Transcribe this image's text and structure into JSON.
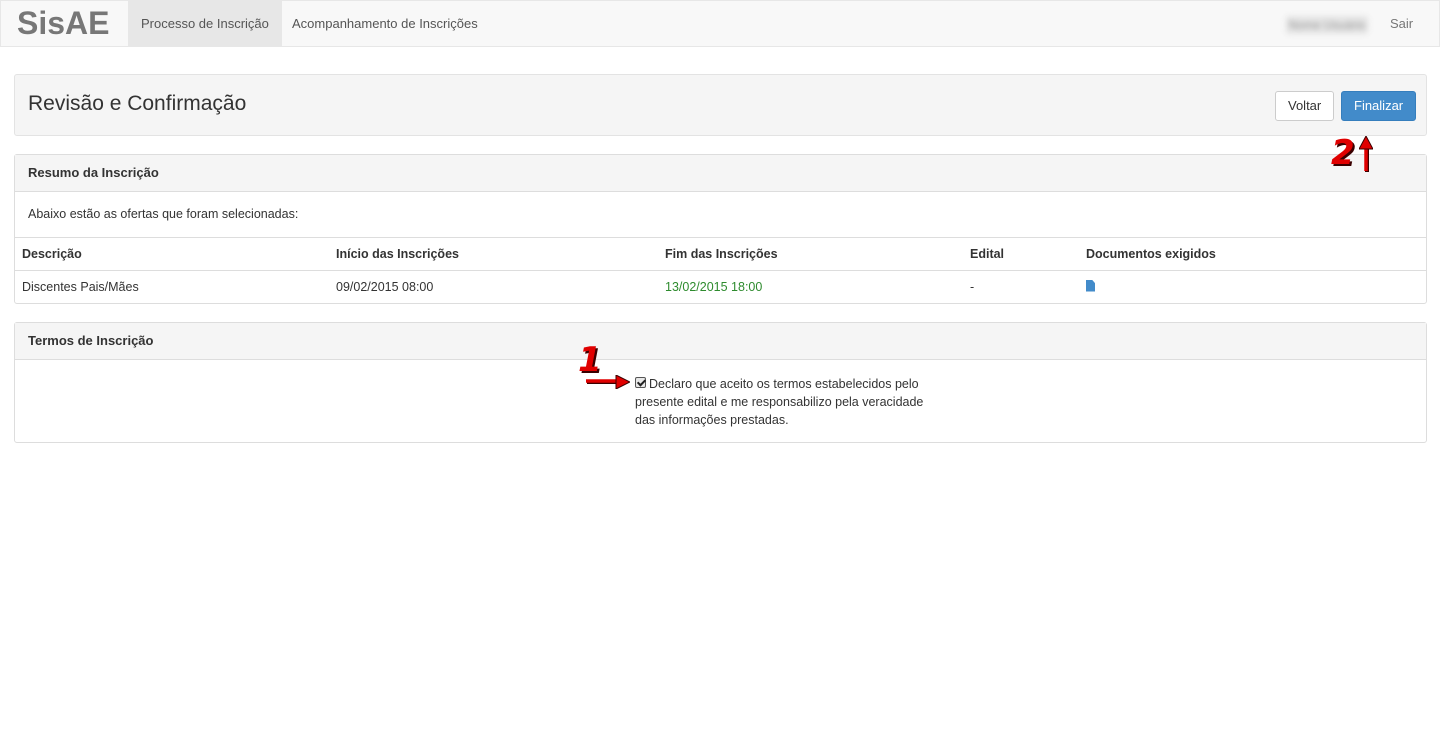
{
  "navbar": {
    "brand": "SisAE",
    "items": [
      {
        "label": "Processo de Inscrição",
        "active": true
      },
      {
        "label": "Acompanhamento de Inscrições",
        "active": false
      }
    ],
    "user_name": "Nome Usuário",
    "logout": "Sair"
  },
  "header": {
    "title": "Revisão e Confirmação",
    "back_label": "Voltar",
    "finish_label": "Finalizar"
  },
  "summary": {
    "heading": "Resumo da Inscrição",
    "intro": "Abaixo estão as ofertas que foram selecionadas:",
    "columns": [
      "Descrição",
      "Início das Inscrições",
      "Fim das Inscrições",
      "Edital",
      "Documentos exigidos"
    ],
    "rows": [
      {
        "descricao": "Discentes Pais/Mães",
        "inicio": "09/02/2015 08:00",
        "fim": "13/02/2015 18:00",
        "edital": "-",
        "documentos_icon": "file-icon"
      }
    ]
  },
  "terms": {
    "heading": "Termos de Inscrição",
    "checked": true,
    "text": "Declaro que aceito os termos estabelecidos pelo presente edital e me responsabilizo pela veracidade das informações prestadas."
  },
  "annotations": {
    "step1": "1",
    "step2": "2",
    "color": "#e00000"
  },
  "colors": {
    "primary": "#428bca",
    "date_green": "#2e8b2e"
  }
}
